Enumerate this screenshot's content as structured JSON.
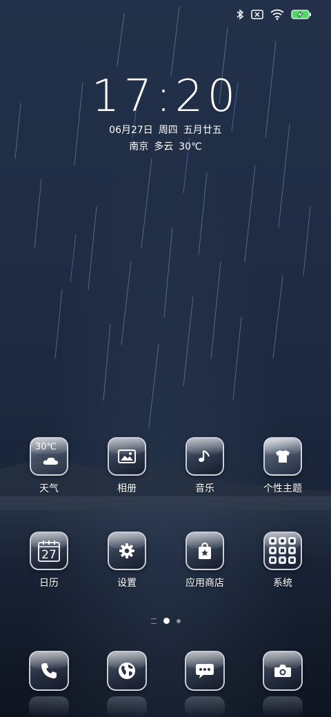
{
  "status_bar": {
    "icons": [
      "bluetooth-icon",
      "no-sim-icon",
      "wifi-icon",
      "battery-charging-icon"
    ],
    "battery_color": "#4cd964"
  },
  "lock_widget": {
    "time": "17:20",
    "date": "06月27日",
    "weekday": "周四",
    "lunar_date": "五月廿五",
    "city": "南京",
    "condition": "多云",
    "temperature": "30℃"
  },
  "apps_row1": [
    {
      "label": "天气",
      "icon": "weather-icon",
      "icon_text": "30℃"
    },
    {
      "label": "相册",
      "icon": "gallery-icon"
    },
    {
      "label": "音乐",
      "icon": "music-note-icon"
    },
    {
      "label": "个性主题",
      "icon": "theme-shirt-icon"
    }
  ],
  "apps_row2": [
    {
      "label": "日历",
      "icon": "calendar-icon",
      "icon_text": "27"
    },
    {
      "label": "设置",
      "icon": "gear-icon"
    },
    {
      "label": "应用商店",
      "icon": "store-bag-icon"
    },
    {
      "label": "系统",
      "icon": "folder-icon"
    }
  ],
  "dock": [
    {
      "icon": "phone-icon"
    },
    {
      "icon": "browser-globe-icon"
    },
    {
      "icon": "messages-icon"
    },
    {
      "icon": "camera-icon"
    }
  ],
  "page_indicator": {
    "pages": 2,
    "current": 1
  }
}
